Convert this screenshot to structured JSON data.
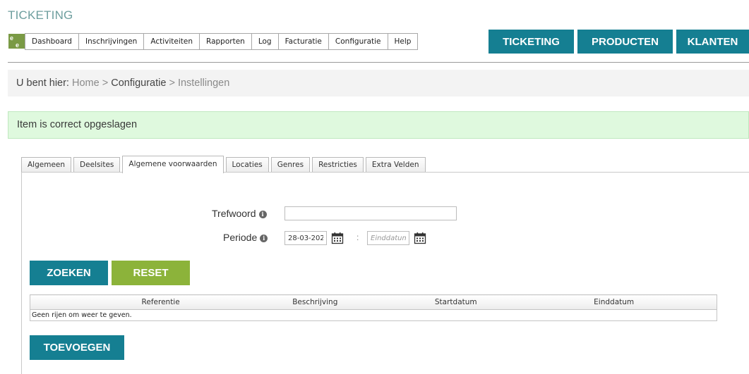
{
  "app": {
    "title": "TICKETING"
  },
  "logo": {
    "line1": "e",
    "line2": "e"
  },
  "nav": {
    "items": [
      "Dashboard",
      "Inschrijvingen",
      "Activiteiten",
      "Rapporten",
      "Log",
      "Facturatie",
      "Configuratie",
      "Help"
    ]
  },
  "modules": {
    "ticketing": "TICKETING",
    "producten": "PRODUCTEN",
    "klanten": "KLANTEN"
  },
  "breadcrumb": {
    "prefix": "U bent hier:",
    "home": "Home",
    "sep1": ">",
    "configuratie": "Configuratie",
    "sep2": ">",
    "current": "Instellingen"
  },
  "alert": {
    "message": "Item is correct opgeslagen"
  },
  "tabs": [
    "Algemeen",
    "Deelsites",
    "Algemene voorwaarden",
    "Locaties",
    "Genres",
    "Restricties",
    "Extra Velden"
  ],
  "active_tab": "Algemene voorwaarden",
  "form": {
    "trefwoord_label": "Trefwoord",
    "trefwoord_value": "",
    "periode_label": "Periode",
    "start_value": "28-03-202",
    "range_separator": ":",
    "end_placeholder": "Einddatum"
  },
  "buttons": {
    "zoeken": "ZOEKEN",
    "reset": "RESET",
    "toevoegen": "TOEVOEGEN"
  },
  "grid": {
    "columns": [
      "Referentie",
      "Beschrijving",
      "Startdatum",
      "Einddatum"
    ],
    "empty_message": "Geen rijen om weer te geven."
  },
  "icons": {
    "info": "info-icon",
    "calendar": "calendar-icon"
  },
  "colors": {
    "primary": "#157f92",
    "accent": "#8cb33a",
    "success_bg": "#dff9de",
    "title": "#6d9e9e"
  }
}
